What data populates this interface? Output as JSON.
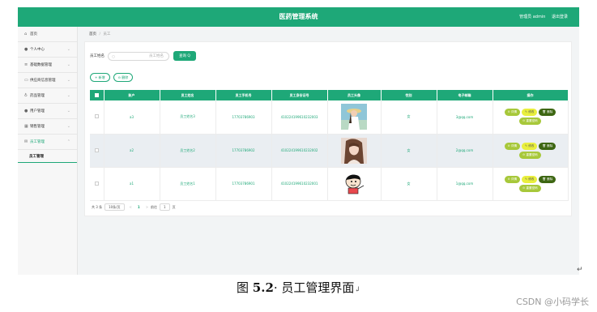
{
  "header": {
    "title": "医药管理系统",
    "user_label": "管理员 admin",
    "logout_label": "退出登录"
  },
  "sidebar": {
    "items": [
      {
        "label": "首页",
        "icon": "home-icon",
        "has_children": false
      },
      {
        "label": "个人中心",
        "icon": "user-icon",
        "has_children": true
      },
      {
        "label": "基础数据管理",
        "icon": "list-icon",
        "has_children": true
      },
      {
        "label": "供应商信息管理",
        "icon": "card-icon",
        "has_children": true
      },
      {
        "label": "药品管理",
        "icon": "pill-icon",
        "has_children": true
      },
      {
        "label": "用户管理",
        "icon": "user-icon",
        "has_children": true
      },
      {
        "label": "销售管理",
        "icon": "grid-icon",
        "has_children": true
      },
      {
        "label": "员工管理",
        "icon": "mail-icon",
        "has_children": true,
        "active": true
      }
    ],
    "sub_item": "员工管理"
  },
  "breadcrumb": {
    "home": "首页",
    "separator": "/",
    "current": "员工"
  },
  "search": {
    "label": "员工姓名",
    "placeholder": "员工姓名",
    "button": "查询 Q"
  },
  "actions": {
    "add": "+ 新增",
    "delete": "⊖ 删除"
  },
  "table": {
    "headers": [
      "",
      "账户",
      "员工姓名",
      "员工手机号",
      "员工身份证号",
      "员工头像",
      "性别",
      "电子邮箱",
      "操作"
    ],
    "rows": [
      {
        "account": "a3",
        "name": "员工姓名3",
        "phone": "17703786903",
        "id_card": "410224199610232003",
        "avatar": "girl-with-hat-photo",
        "gender": "女",
        "email": "3@qq.com"
      },
      {
        "account": "a2",
        "name": "员工姓名2",
        "phone": "17703786902",
        "id_card": "410224199610232002",
        "avatar": "girl-portrait-photo",
        "gender": "女",
        "email": "2@qq.com"
      },
      {
        "account": "a1",
        "name": "员工姓名1",
        "phone": "17703786901",
        "id_card": "410224199610232001",
        "avatar": "cartoon-boy-avatar",
        "gender": "女",
        "email": "1@qq.com"
      }
    ],
    "ops": {
      "detail": "⊙ 详情",
      "edit": "✎ 修改",
      "delete": "🗑 删除",
      "reset": "⊙ 重置密码"
    }
  },
  "pager": {
    "total": "共 3 条",
    "page_size": "10条/页",
    "prev": "<",
    "page": "1",
    "next": ">",
    "goto_label": "前往",
    "goto_value": "1",
    "page_suffix": "页"
  },
  "caption": {
    "prefix": "图 ",
    "number": "5.2",
    "text": "· 员工管理界面",
    "mark": "↲"
  },
  "watermark": "CSDN @小码学长",
  "colors": {
    "accent": "#1ea878",
    "detail_btn": "#a7c83a",
    "edit_btn": "#e9ef3d",
    "delete_btn": "#3d6612"
  }
}
